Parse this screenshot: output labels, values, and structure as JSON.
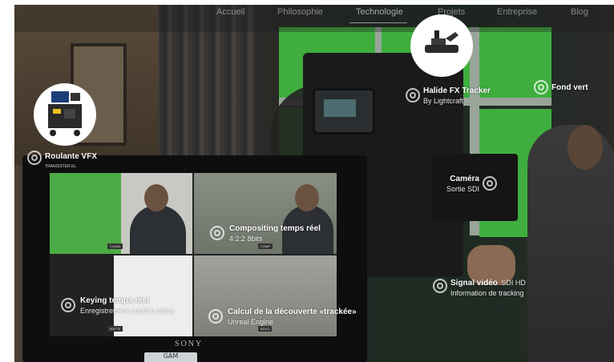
{
  "nav": {
    "items": [
      {
        "label": "Accueil"
      },
      {
        "label": "Philosophie"
      },
      {
        "label": "Technologie"
      },
      {
        "label": "Projets"
      },
      {
        "label": "Entreprise"
      },
      {
        "label": "Blog"
      }
    ],
    "active": "Technologie"
  },
  "hotspots": {
    "roulante": {
      "title": "Roulante VFX",
      "subtitle": "TRANSISTER EL"
    },
    "halide": {
      "title": "Halide FX Tracker",
      "subtitle": "By Lightcraft"
    },
    "fond_vert": {
      "title": "Fond vert"
    },
    "camera": {
      "title": "Caméra",
      "subtitle": "Sortie SDI"
    },
    "signal": {
      "title": "Signal vidéo",
      "title_suffix": "SDI HD",
      "subtitle": "Information de tracking"
    },
    "compositing": {
      "title": "Compositing temps réel",
      "subtitle": "4:2:2 8bits"
    },
    "keying": {
      "title": "Keying temps réel",
      "subtitle": "Enregistrement couche alpha"
    },
    "calcul": {
      "title": "Calcul de la découverte «trackée»",
      "subtitle": "Unreal Engine"
    }
  },
  "monitor": {
    "brand": "SONY",
    "quad_tags": [
      "CLEAN",
      "COMP",
      "MATTE",
      "BCKG"
    ],
    "box_label": "GAM"
  },
  "colors": {
    "green_screen": "#3fae3e",
    "hotspot_ring": "#ffffff"
  }
}
